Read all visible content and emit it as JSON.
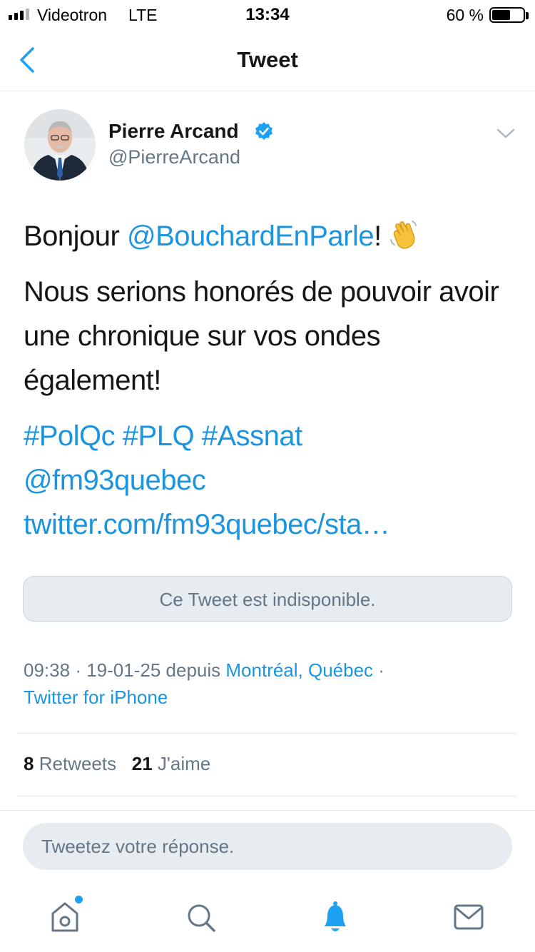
{
  "status_bar": {
    "carrier": "Videotron",
    "network": "LTE",
    "time": "13:34",
    "battery_percent": "60 %",
    "battery_level": 0.6
  },
  "nav": {
    "title": "Tweet"
  },
  "tweet": {
    "author_name": "Pierre Arcand",
    "author_handle": "@PierreArcand",
    "verified": true,
    "line1_text": "Bonjour ",
    "line1_mention": "@BouchardEnParle",
    "line1_after": "!",
    "paragraph2": "Nous serions honorés de pouvoir avoir une chronique sur vos ondes également!",
    "hashtags": [
      "#PolQc",
      "#PLQ",
      "#Assnat"
    ],
    "mention2": "@fm93quebec",
    "link_text": "twitter.com/fm93quebec/sta…",
    "unavailable_text": "Ce Tweet est indisponible.",
    "time": "09:38",
    "date": "19-01-25",
    "source_prefix": "depuis",
    "location": "Montréal, Québec",
    "client": "Twitter for iPhone",
    "separator": "·"
  },
  "stats": {
    "retweets_count": "8",
    "retweets_label": "Retweets",
    "likes_count": "21",
    "likes_label": "J'aime"
  },
  "reply": {
    "placeholder": "Tweetez votre réponse."
  },
  "tabs": [
    {
      "name": "home",
      "icon": "home-icon",
      "active": false,
      "has_badge": true
    },
    {
      "name": "search",
      "icon": "search-icon",
      "active": false
    },
    {
      "name": "notifications",
      "icon": "bell-icon",
      "active": true
    },
    {
      "name": "messages",
      "icon": "mail-icon",
      "active": false
    }
  ],
  "colors": {
    "accent": "#1da1f2",
    "link": "#1b95e0",
    "text": "#14171a",
    "secondary": "#657786",
    "divider": "#e1e8ed"
  }
}
